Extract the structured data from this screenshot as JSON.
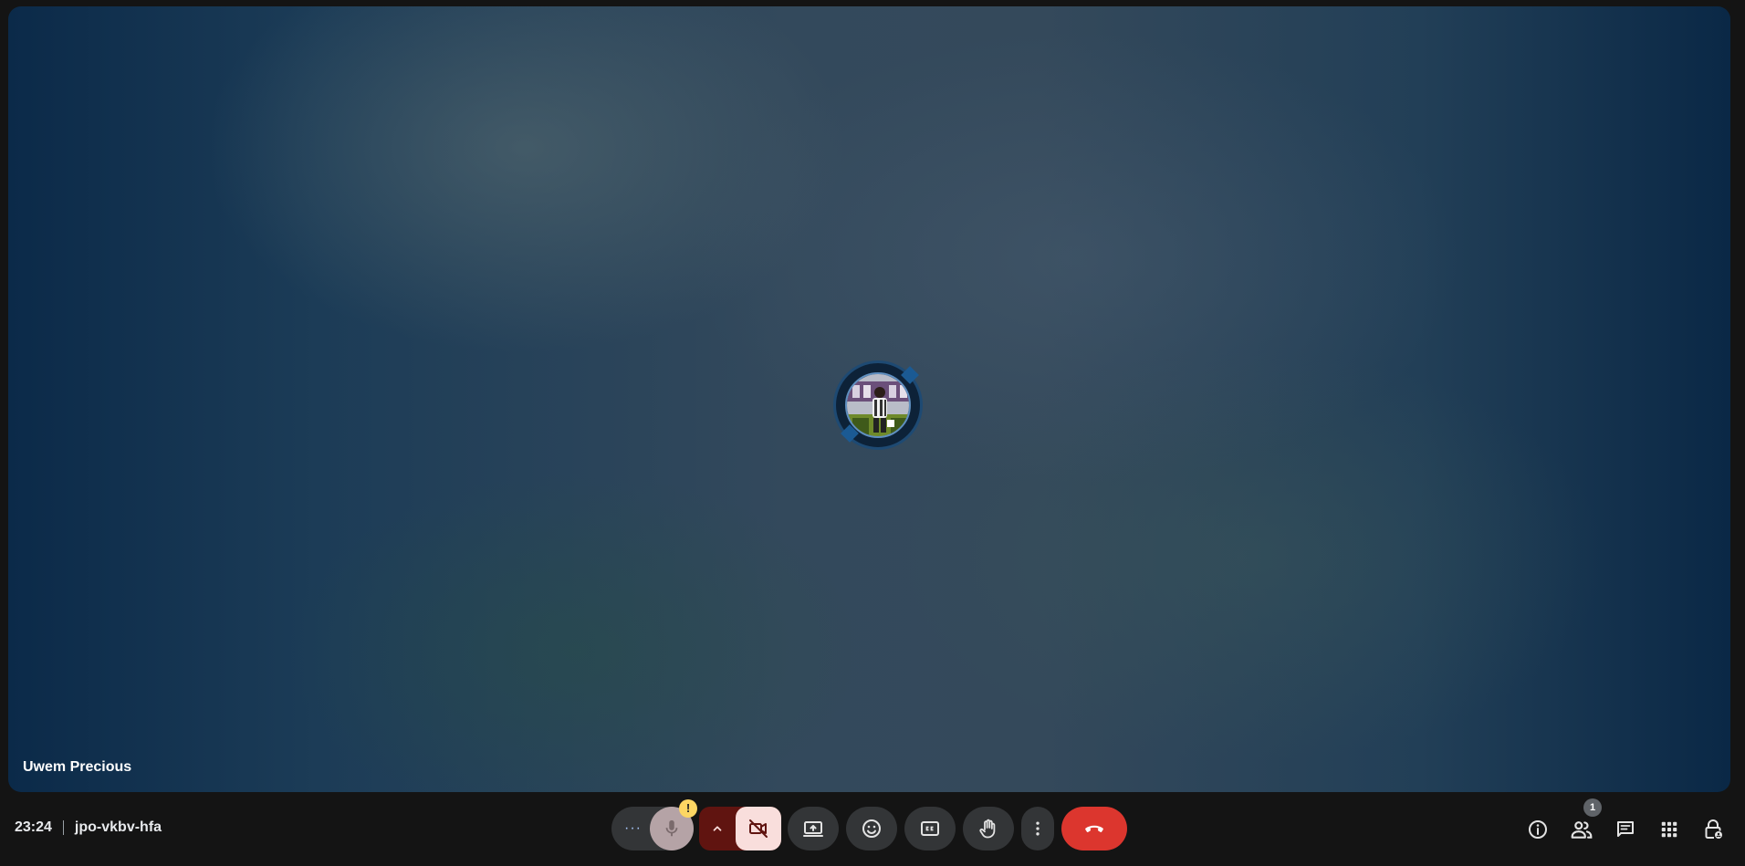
{
  "participant": {
    "name": "Uwem Precious"
  },
  "meeting": {
    "time": "23:24",
    "code": "jpo-vkbv-hfa"
  },
  "controls": {
    "more_dots": "···",
    "mic_warning": "!",
    "icons": {
      "mic": "mic-icon",
      "camera": "camera-off-icon",
      "present": "present-screen-icon",
      "emoji": "emoji-icon",
      "captions": "closed-captions-icon",
      "hand": "raise-hand-icon",
      "more": "more-vert-icon",
      "end": "end-call-icon"
    }
  },
  "side_panel": {
    "people_count": "1",
    "icons": [
      "info-icon",
      "people-icon",
      "chat-icon",
      "apps-grid-icon",
      "host-controls-lock-icon"
    ]
  },
  "colors": {
    "end_call": "#dc362e",
    "camera_off_bg": "#f9dedc",
    "camera_group_bg": "#601410",
    "warning": "#fdd663",
    "control_bg": "#333537"
  }
}
